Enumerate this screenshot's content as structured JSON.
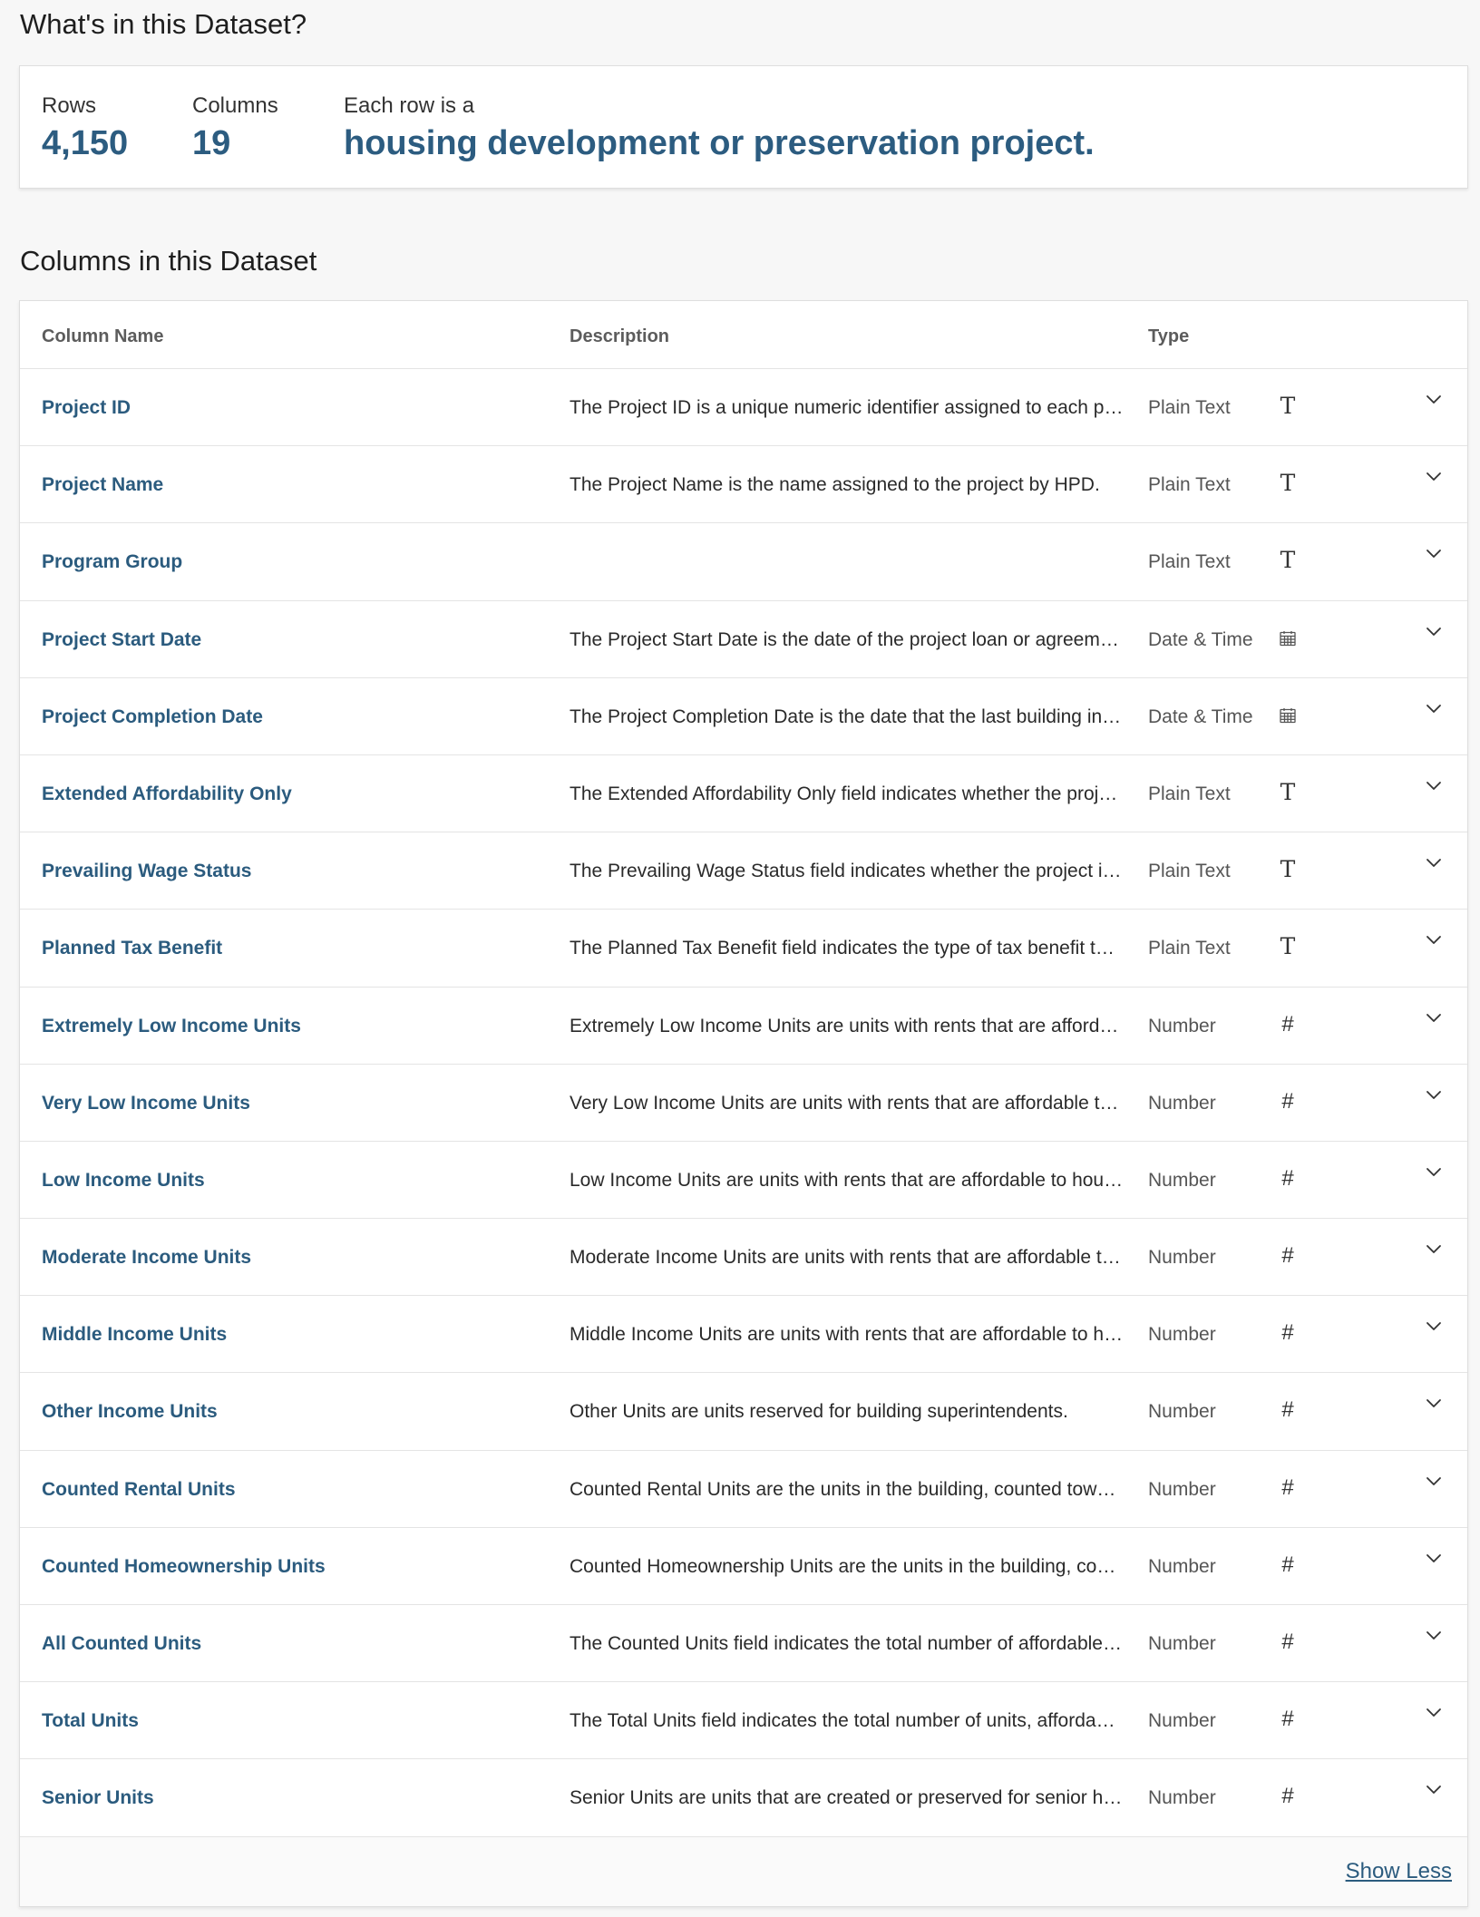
{
  "summary": {
    "title": "What's in this Dataset?",
    "rows_label": "Rows",
    "rows_value": "4,150",
    "columns_label": "Columns",
    "columns_value": "19",
    "each_row_label": "Each row is a",
    "each_row_value": "housing development or preservation project."
  },
  "columns_section": {
    "title": "Columns in this Dataset",
    "headers": {
      "name": "Column Name",
      "description": "Description",
      "type": "Type"
    },
    "rows": [
      {
        "name": "Project ID",
        "description": "The Project ID is a unique numeric identifier assigned to each project by HPD.",
        "type": "Plain Text",
        "icon": "text-type-icon"
      },
      {
        "name": "Project Name",
        "description": "The Project Name is the name assigned to the project by HPD.",
        "type": "Plain Text",
        "icon": "text-type-icon"
      },
      {
        "name": "Program Group",
        "description": "",
        "type": "Plain Text",
        "icon": "text-type-icon"
      },
      {
        "name": "Project Start Date",
        "description": "The Project Start Date is the date of the project loan or agreement closing.",
        "type": "Date & Time",
        "icon": "calendar-type-icon"
      },
      {
        "name": "Project Completion Date",
        "description": "The Project Completion Date is the date that the last building in the project was completed.",
        "type": "Date & Time",
        "icon": "calendar-type-icon"
      },
      {
        "name": "Extended Affordability Only",
        "description": "The Extended Affordability Only field indicates whether the project is considered to be Extended Affordability.",
        "type": "Plain Text",
        "icon": "text-type-icon"
      },
      {
        "name": "Prevailing Wage Status",
        "description": "The Prevailing Wage Status field indicates whether the project is subject to prevailing wage requirements.",
        "type": "Plain Text",
        "icon": "text-type-icon"
      },
      {
        "name": "Planned Tax Benefit",
        "description": "The Planned Tax Benefit field indicates the type of tax benefit that the project is planned to receive.",
        "type": "Plain Text",
        "icon": "text-type-icon"
      },
      {
        "name": "Extremely Low Income Units",
        "description": "Extremely Low Income Units are units with rents that are affordable to households earning 0 to 30% of the area median income (AMI).",
        "type": "Number",
        "icon": "number-type-icon"
      },
      {
        "name": "Very Low Income Units",
        "description": "Very Low Income Units are units with rents that are affordable to households earning 31 to 50% of the area median income (AMI).",
        "type": "Number",
        "icon": "number-type-icon"
      },
      {
        "name": "Low Income Units",
        "description": "Low Income Units are units with rents that are affordable to households earning 51 to 80% of the area median income (AMI).",
        "type": "Number",
        "icon": "number-type-icon"
      },
      {
        "name": "Moderate Income Units",
        "description": "Moderate Income Units are units with rents that are affordable to households earning 81 to 120% of the area median income (AMI).",
        "type": "Number",
        "icon": "number-type-icon"
      },
      {
        "name": "Middle Income Units",
        "description": "Middle Income Units are units with rents that are affordable to households earning 121 to 165% of the area median income (AMI).",
        "type": "Number",
        "icon": "number-type-icon"
      },
      {
        "name": "Other Income Units",
        "description": "Other Units are units reserved for building superintendents.",
        "type": "Number",
        "icon": "number-type-icon"
      },
      {
        "name": "Counted Rental Units",
        "description": "Counted Rental Units are the units in the building, counted toward the Housing Plan, where assistance has been provided to landlords.",
        "type": "Number",
        "icon": "number-type-icon"
      },
      {
        "name": "Counted Homeownership Units",
        "description": "Counted Homeownership Units are the units in the building, counted toward the Housing Plan, where assistance has been provided directly to homeowners.",
        "type": "Number",
        "icon": "number-type-icon"
      },
      {
        "name": "All Counted Units",
        "description": "The Counted Units field indicates the total number of affordable units, both rental and homeownership, that count toward the Housing Plan.",
        "type": "Number",
        "icon": "number-type-icon"
      },
      {
        "name": "Total Units",
        "description": "The Total Units field indicates the total number of units, affordable and market rate, in each building.",
        "type": "Number",
        "icon": "number-type-icon"
      },
      {
        "name": "Senior Units",
        "description": "Senior Units are units that are created or preserved for senior households.",
        "type": "Number",
        "icon": "number-type-icon"
      }
    ],
    "show_less_label": "Show Less"
  },
  "colors": {
    "accent": "#2c5c80",
    "link": "#2b5b7e",
    "background": "#f7f7f7",
    "card": "#ffffff"
  }
}
